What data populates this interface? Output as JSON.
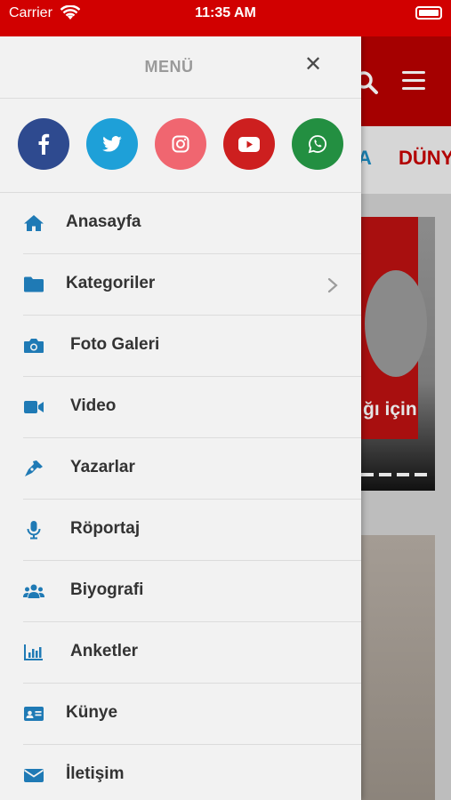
{
  "status_bar": {
    "carrier": "Carrier",
    "time": "11:35 AM"
  },
  "background": {
    "category_partial_1": "A",
    "category_partial_2": "DÜNY",
    "headline_fragment": "ğı için"
  },
  "drawer": {
    "title": "MENÜ",
    "close_symbol": "✕",
    "social": [
      {
        "name": "facebook",
        "color": "#2e4a8f"
      },
      {
        "name": "twitter",
        "color": "#1ea0d8"
      },
      {
        "name": "instagram",
        "color": "#f06670"
      },
      {
        "name": "youtube",
        "color": "#cd1f1f"
      },
      {
        "name": "whatsapp",
        "color": "#238f41"
      }
    ],
    "accent_color": "#1f7ab5",
    "items": [
      {
        "label": "Anasayfa",
        "icon": "home-icon"
      },
      {
        "label": "Kategoriler",
        "icon": "folder-icon",
        "has_submenu": true
      },
      {
        "label": "Foto Galeri",
        "icon": "camera-icon"
      },
      {
        "label": "Video",
        "icon": "video-camera-icon"
      },
      {
        "label": "Yazarlar",
        "icon": "pen-icon"
      },
      {
        "label": "Röportaj",
        "icon": "microphone-icon"
      },
      {
        "label": "Biyografi",
        "icon": "users-icon"
      },
      {
        "label": "Anketler",
        "icon": "bar-chart-icon"
      },
      {
        "label": "Künye",
        "icon": "id-card-icon"
      },
      {
        "label": "İletişim",
        "icon": "envelope-icon"
      }
    ]
  }
}
